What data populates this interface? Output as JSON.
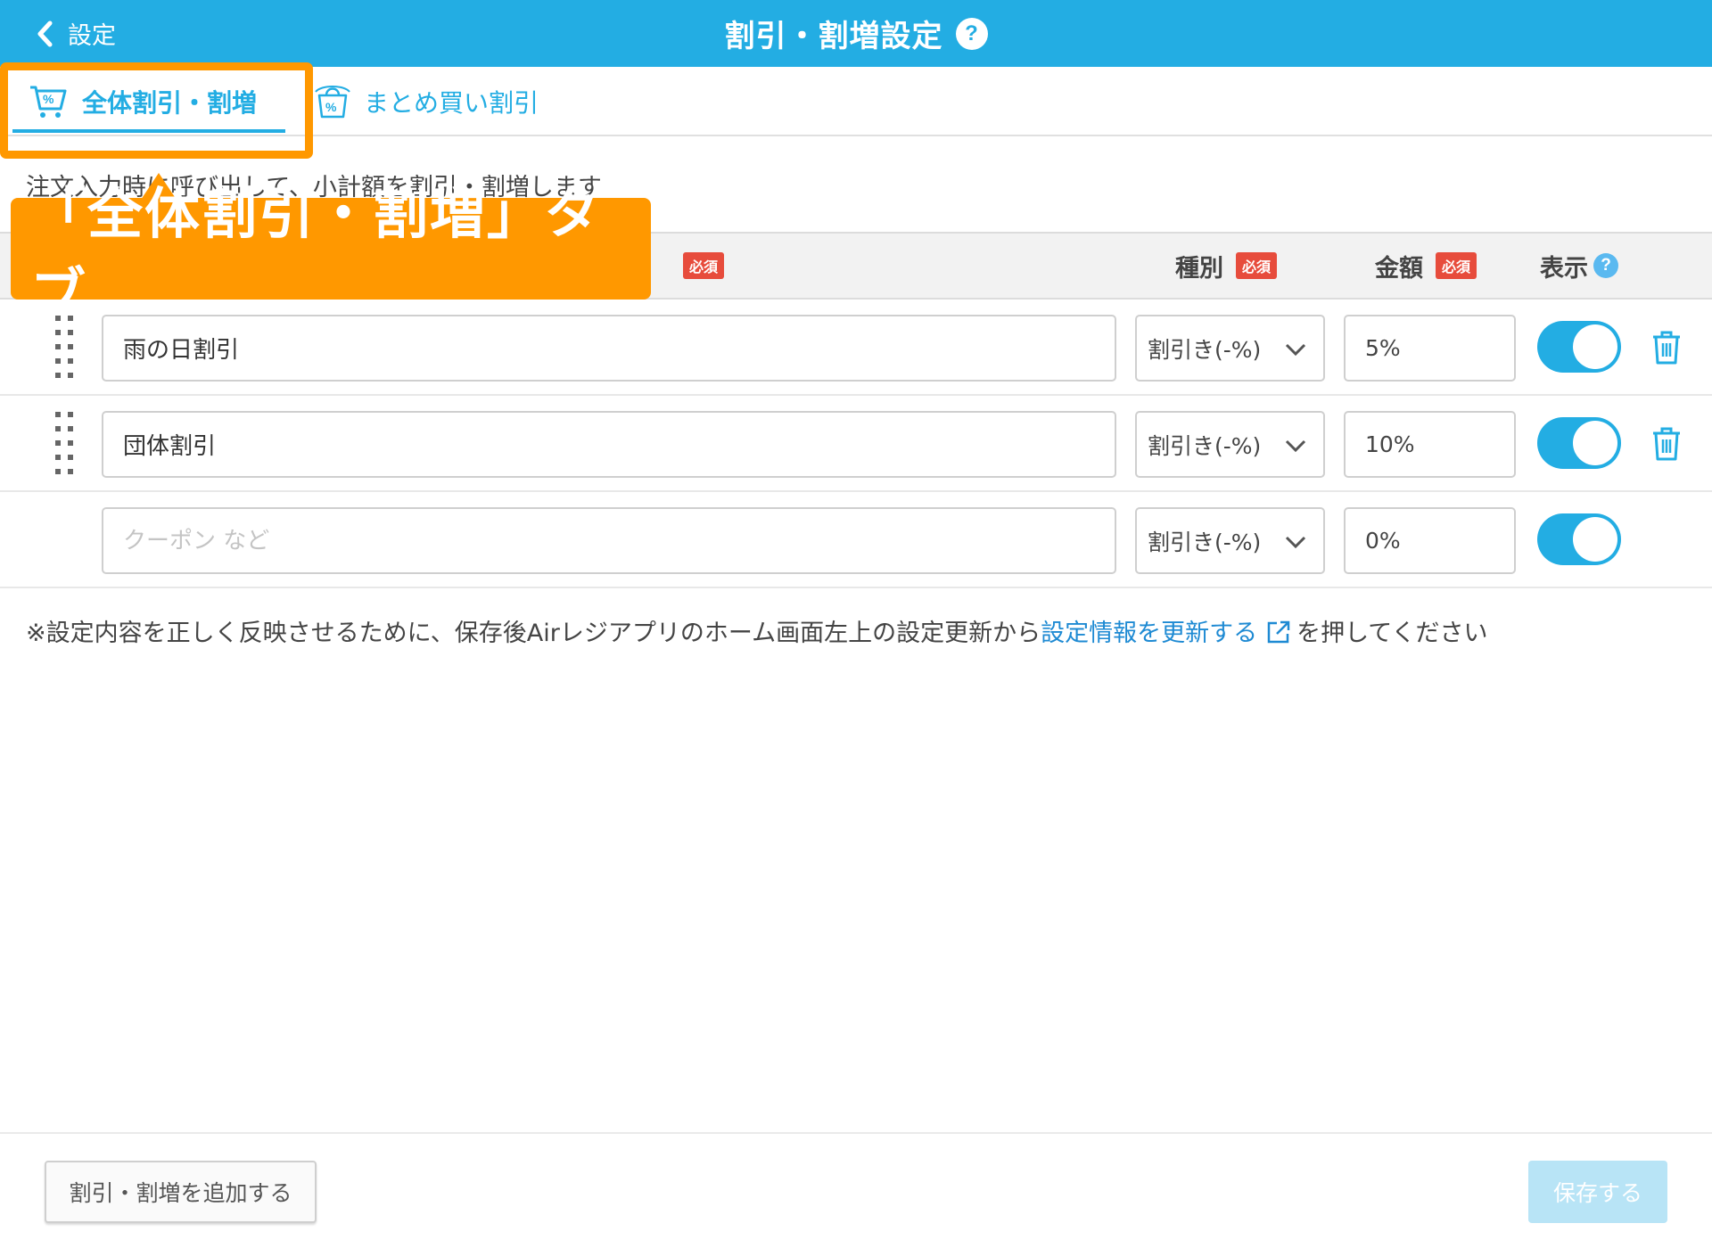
{
  "header": {
    "back_label": "設定",
    "title": "割引・割増設定",
    "help_label": "?"
  },
  "tabs": [
    {
      "label": "全体割引・割増",
      "active": true,
      "icon": "cart-percent-icon"
    },
    {
      "label": "まとめ買い割引",
      "active": false,
      "icon": "bags-percent-icon"
    }
  ],
  "description": "注文入力時に呼び出して、小計額を割引・割増します",
  "callout": {
    "text": "「全体割引・割増」タブ",
    "color": "#ff9800"
  },
  "table": {
    "required_label": "必須",
    "columns": {
      "type": "種別",
      "amount": "金額",
      "display": "表示"
    },
    "rows": [
      {
        "name": "雨の日割引",
        "type": "割引き(-%)",
        "amount": "5%",
        "display_on": true,
        "deletable": true
      },
      {
        "name": "団体割引",
        "type": "割引き(-%)",
        "amount": "10%",
        "display_on": true,
        "deletable": true
      },
      {
        "name": "",
        "name_placeholder": "クーポン など",
        "type": "割引き(-%)",
        "amount": "0%",
        "display_on": true,
        "deletable": false
      }
    ]
  },
  "note": {
    "before": "※設定内容を正しく反映させるために、保存後Airレジアプリのホーム画面左上の設定更新から",
    "link": "設定情報を更新する",
    "after": "を押してください"
  },
  "footer": {
    "add_label": "割引・割増を追加する",
    "save_label": "保存する"
  },
  "colors": {
    "primary": "#23ade3",
    "required": "#e74c3c",
    "accent": "#ff9800",
    "link": "#1e8ad3"
  }
}
